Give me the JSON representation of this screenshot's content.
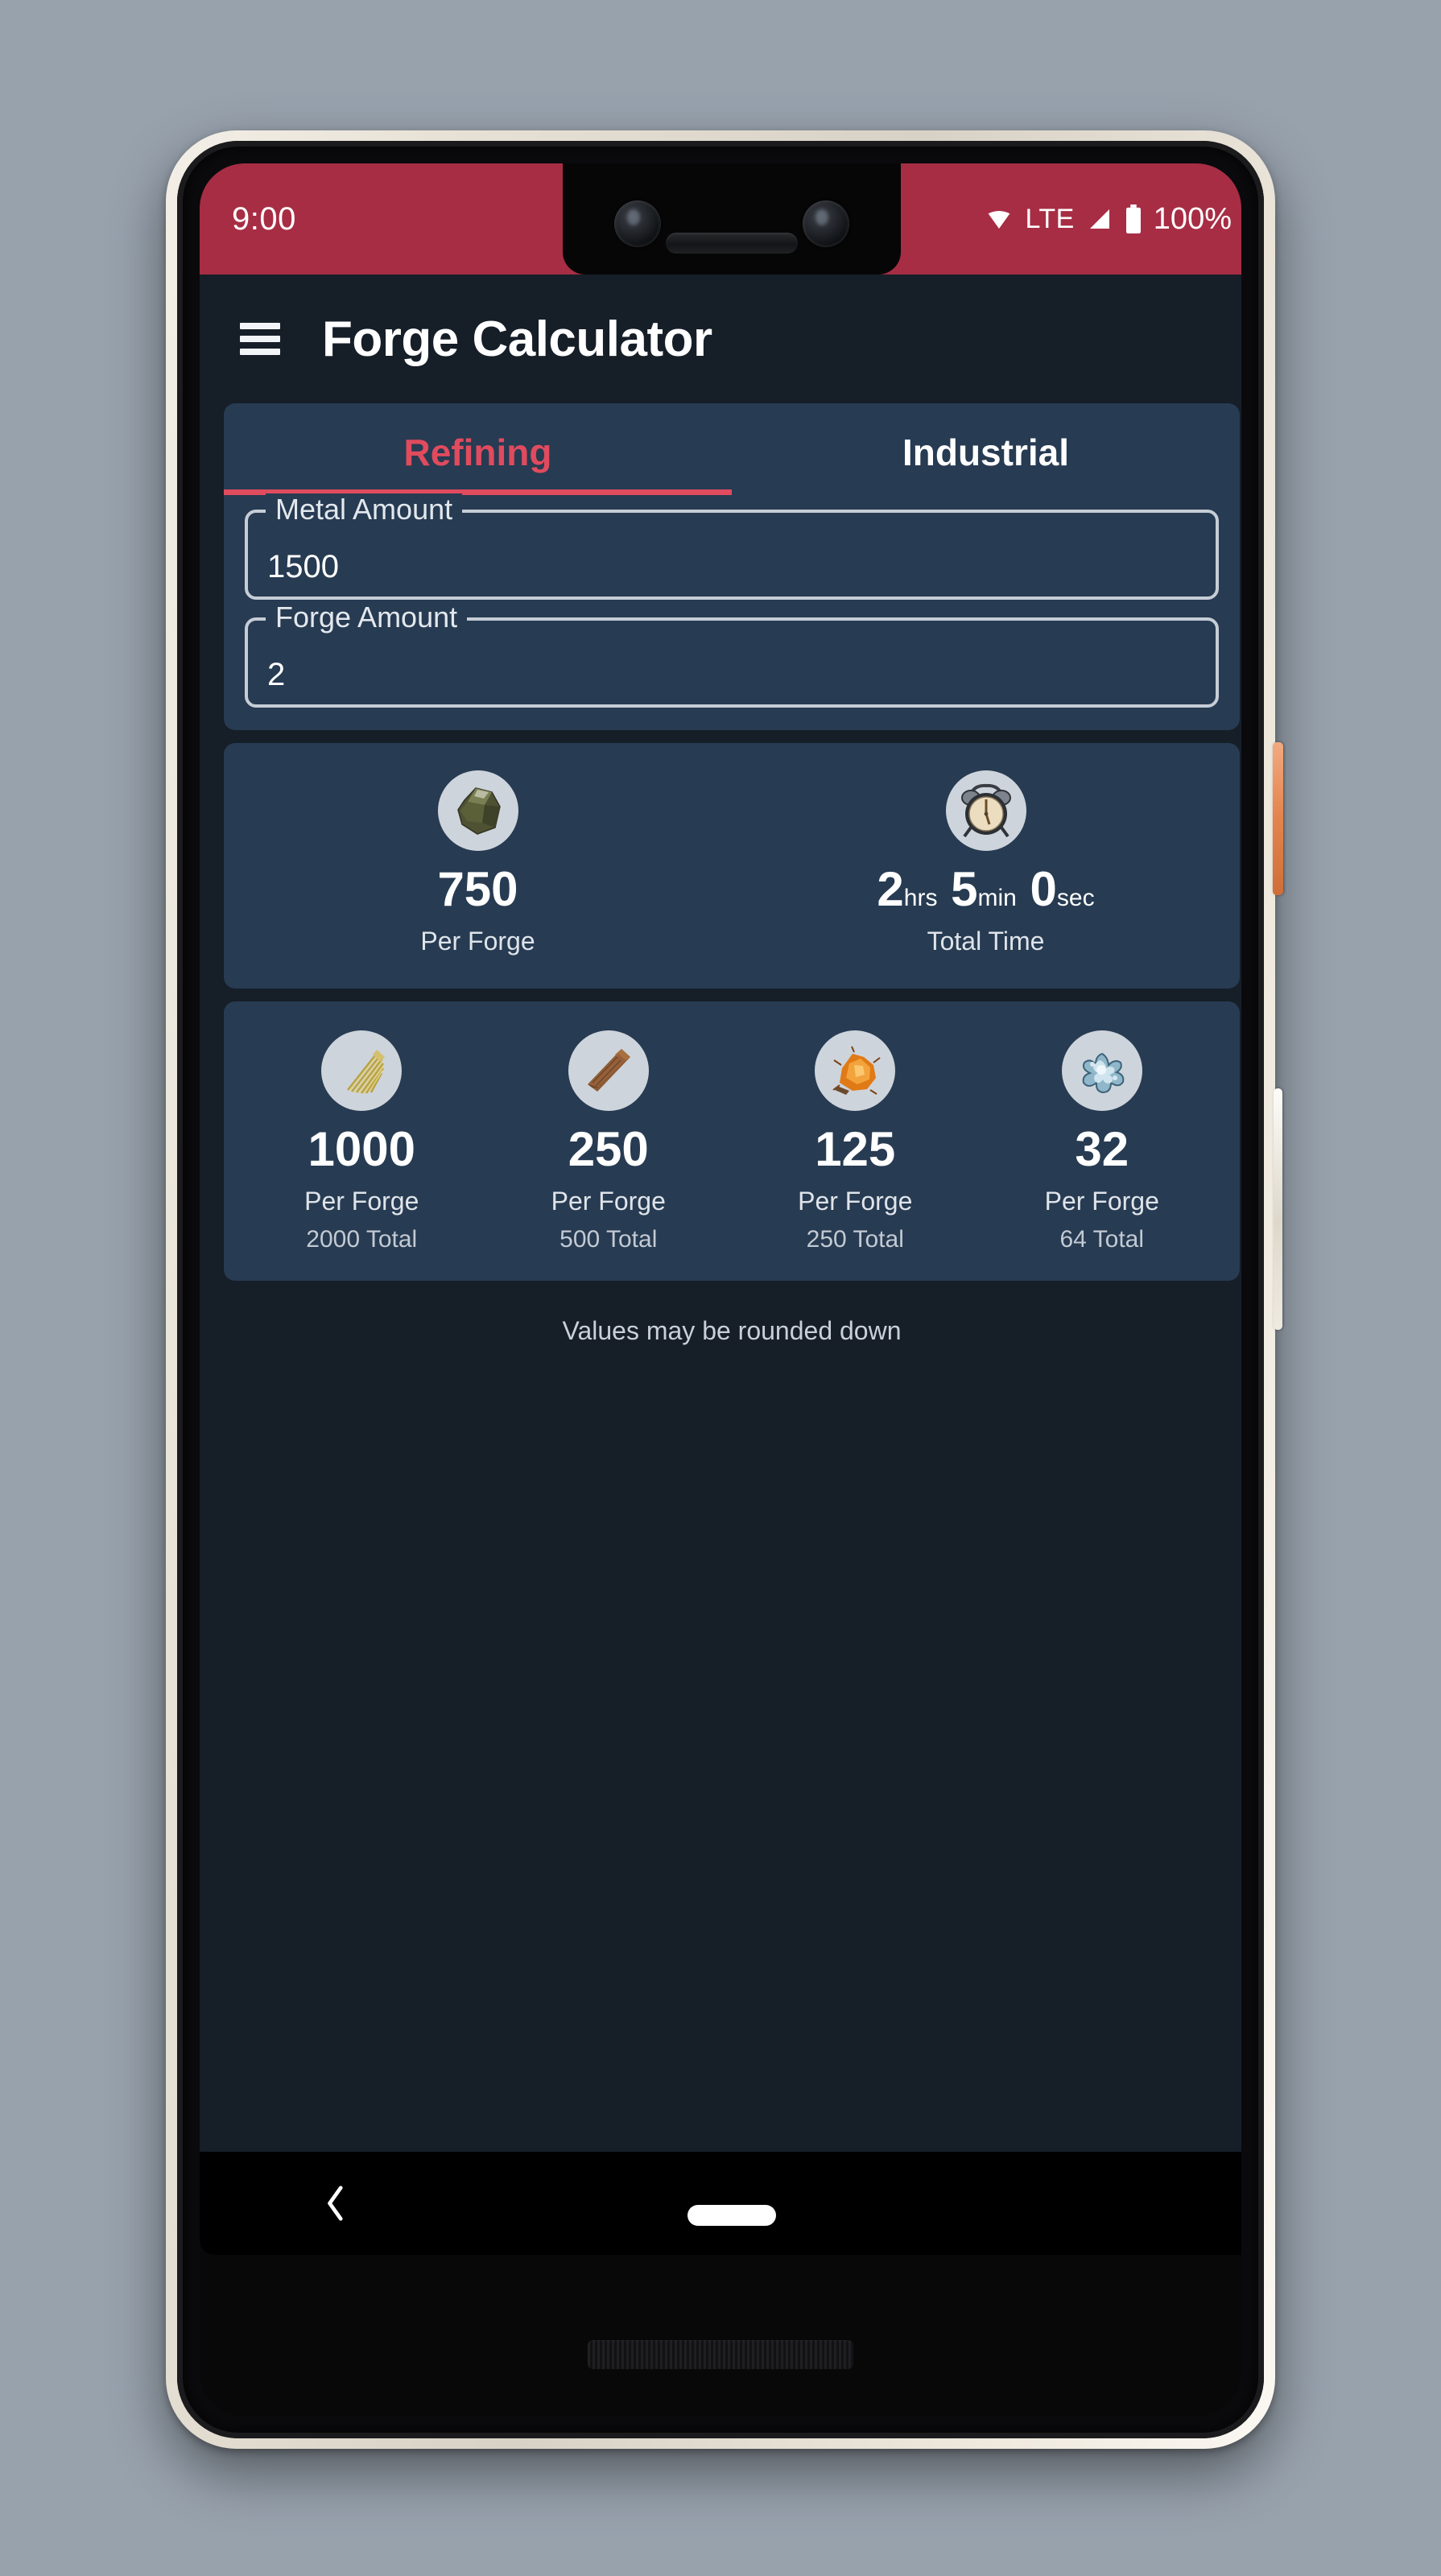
{
  "status_bar": {
    "time": "9:00",
    "network_label": "LTE",
    "battery_percent": "100%",
    "icons": [
      "wifi-icon",
      "signal-icon",
      "battery-icon"
    ],
    "background_color": "#a72d44"
  },
  "app_bar": {
    "menu_icon": "hamburger-menu-icon",
    "title": "Forge Calculator",
    "background_color": "#161e28"
  },
  "tabs": [
    {
      "label": "Refining",
      "active": true
    },
    {
      "label": "Industrial",
      "active": false
    }
  ],
  "accent_color": "#e04b5e",
  "card_color": "#273b52",
  "inputs": [
    {
      "label": "Metal Amount",
      "value": "1500",
      "placeholder": "Metal Amount"
    },
    {
      "label": "Forge Amount",
      "value": "2",
      "placeholder": "Forge Amount"
    }
  ],
  "summary": [
    {
      "icon": "metal-ore-icon",
      "value": "750",
      "units": [],
      "sub": "Per Forge"
    },
    {
      "icon": "alarm-clock-icon",
      "value": "",
      "units": [
        {
          "number": "2",
          "unit": "hrs"
        },
        {
          "number": "5",
          "unit": "min"
        },
        {
          "number": "0",
          "unit": "sec"
        }
      ],
      "sub": "Total Time"
    }
  ],
  "resources": [
    {
      "icon": "fiber-icon",
      "value": "1000",
      "sub": "Per Forge",
      "total": "2000 Total"
    },
    {
      "icon": "wood-icon",
      "value": "250",
      "sub": "Per Forge",
      "total": "500 Total"
    },
    {
      "icon": "sulfur-icon",
      "value": "125",
      "sub": "Per Forge",
      "total": "250 Total"
    },
    {
      "icon": "water-icon",
      "value": "32",
      "sub": "Per Forge",
      "total": "64 Total"
    }
  ],
  "footnote": "Values may be rounded down",
  "nav_bar": {
    "back_icon": "back-chevron-icon",
    "home_icon": "home-pill-icon"
  }
}
